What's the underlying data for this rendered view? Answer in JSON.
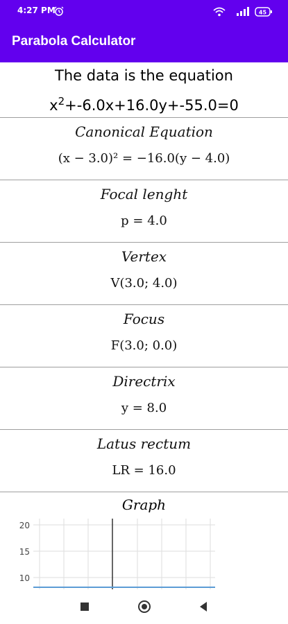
{
  "status_bar": {
    "time": "4:27 PM",
    "icons": [
      "alarm-icon",
      "wifi-icon",
      "signal-icon",
      "battery-icon"
    ],
    "battery": "45"
  },
  "app_bar": {
    "title": "Parabola Calculator",
    "color": "#6200ee"
  },
  "header": {
    "line1": "The data is the equation",
    "eq_prefix": "x",
    "eq_sup": "2",
    "eq_rest": "+-6.0x+16.0y+-55.0=0"
  },
  "sections": [
    {
      "title": "Canonical Equation",
      "value": "(x − 3.0)² = −16.0(y − 4.0)"
    },
    {
      "title": "Focal lenght",
      "value": "p = 4.0"
    },
    {
      "title": "Vertex",
      "value": "V(3.0; 4.0)"
    },
    {
      "title": "Focus",
      "value": "F(3.0; 0.0)"
    },
    {
      "title": "Directrix",
      "value": "y = 8.0"
    },
    {
      "title": "Latus rectum",
      "value": "LR = 16.0"
    }
  ],
  "graph": {
    "title": "Graph",
    "y_ticks": [
      "20",
      "15",
      "10"
    ],
    "line_color": "#5b9bd5"
  },
  "nav_bar": {
    "icons": [
      "recents-icon",
      "home-icon",
      "back-icon"
    ]
  }
}
